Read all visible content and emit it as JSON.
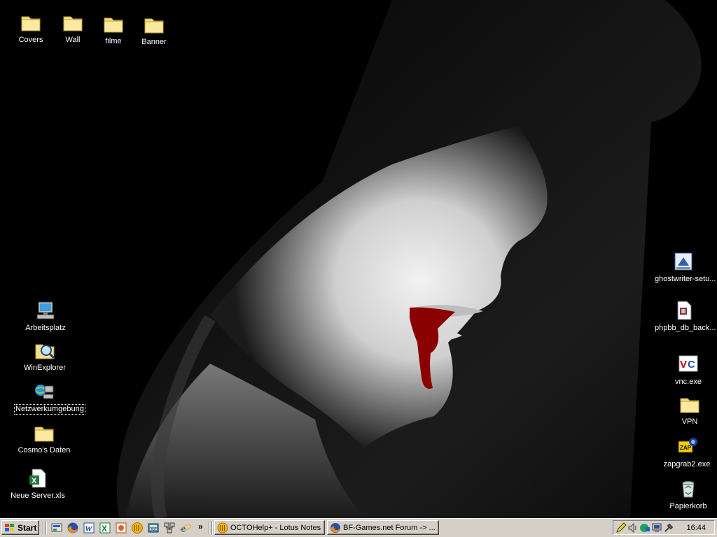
{
  "desktop": {
    "icons_top": [
      {
        "label": "Covers",
        "icon": "folder-icon"
      },
      {
        "label": "Wall",
        "icon": "folder-icon"
      },
      {
        "label": "filme",
        "icon": "folder-icon"
      },
      {
        "label": "Banner",
        "icon": "folder-icon"
      }
    ],
    "icons_left": [
      {
        "label": "Arbeitsplatz",
        "icon": "my-computer-icon"
      },
      {
        "label": "WinExplorer",
        "icon": "explorer-search-icon"
      },
      {
        "label": "Netzwerkumgebung",
        "icon": "network-places-icon"
      },
      {
        "label": "Cosmo's Daten",
        "icon": "folder-icon"
      },
      {
        "label": "Neue Server.xls",
        "icon": "excel-file-icon"
      }
    ],
    "icons_right": [
      {
        "label": "ghostwriter-setu...",
        "icon": "installer-icon"
      },
      {
        "label": "phpbb_db_back...",
        "icon": "script-file-icon"
      },
      {
        "label": "vnc.exe",
        "icon": "vnc-icon"
      },
      {
        "label": "VPN",
        "icon": "folder-icon"
      },
      {
        "label": "zapgrab2.exe",
        "icon": "zapgrab-icon"
      },
      {
        "label": "Papierkorb",
        "icon": "recycle-bin-icon"
      }
    ]
  },
  "taskbar": {
    "start_label": "Start",
    "quicklaunch": [
      "show-desktop-icon",
      "firefox-icon",
      "word-icon",
      "excel-icon",
      "powerpoint-icon",
      "lotus-notes-icon",
      "calculator-icon",
      "network-icon",
      "internet-explorer-icon"
    ],
    "more": "»",
    "tasks": [
      {
        "label": "OCTOHelp+ - Lotus Notes",
        "icon": "lotus-notes-icon"
      },
      {
        "label": "BF-Games.net Forum -> ...",
        "icon": "firefox-icon"
      }
    ],
    "tray_icons": [
      "pencil-icon",
      "volume-icon",
      "network-tray-icon",
      "display-icon",
      "tools-icon"
    ],
    "clock": "16:44"
  },
  "colors": {
    "taskbar_bg": "#d4d0c8",
    "wallpaper_bg": "#000000",
    "blood": "#8b0000"
  }
}
